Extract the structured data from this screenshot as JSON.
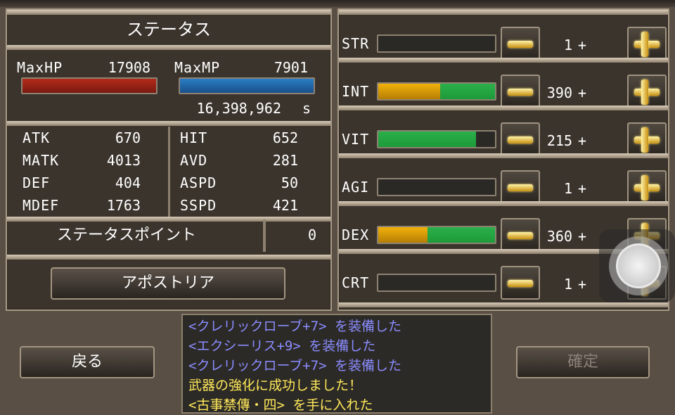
{
  "status_panel": {
    "title": "ステータス",
    "maxhp_label": "MaxHP",
    "maxhp_value": "17908",
    "maxmp_label": "MaxMP",
    "maxmp_value": "7901",
    "hp_fill": 1.0,
    "mp_fill": 1.0,
    "hp_color": "#b32a1a",
    "mp_color": "#2a7ec4",
    "time_value": "16,398,962",
    "time_unit": "s",
    "stats": [
      {
        "label": "ATK",
        "value": "670"
      },
      {
        "label": "MATK",
        "value": "4013"
      },
      {
        "label": "DEF",
        "value": "404"
      },
      {
        "label": "MDEF",
        "value": "1763"
      }
    ],
    "stats_right": [
      {
        "label": "HIT",
        "value": "652"
      },
      {
        "label": "AVD",
        "value": "281"
      },
      {
        "label": "ASPD",
        "value": "50"
      },
      {
        "label": "SSPD",
        "value": "421"
      }
    ],
    "points_label": "ステータスポイント",
    "points_value": "0",
    "class_button": "アポストリア"
  },
  "attributes": [
    {
      "label": "STR",
      "value": "1",
      "yellow": 0,
      "green": 0
    },
    {
      "label": "INT",
      "value": "390",
      "yellow": 0.53,
      "green": 0.47
    },
    {
      "label": "VIT",
      "value": "215",
      "yellow": 0,
      "green": 0.84
    },
    {
      "label": "AGI",
      "value": "1",
      "yellow": 0,
      "green": 0
    },
    {
      "label": "DEX",
      "value": "360",
      "yellow": 0.42,
      "green": 0.58
    },
    {
      "label": "CRT",
      "value": "1",
      "yellow": 0,
      "green": 0
    }
  ],
  "plus_suffix": "+",
  "colors": {
    "yellow": "#f2b20a",
    "green": "#1e9a3a",
    "log_blue": "#8a8cff",
    "log_yellow": "#ffe85a"
  },
  "footer": {
    "back_button": "戻る",
    "confirm_button": "確定"
  },
  "log": [
    {
      "text": "<クレリックローブ+7> を装備した",
      "color": "blue"
    },
    {
      "text": "<エクシーリス+9> を装備した",
      "color": "blue"
    },
    {
      "text": "<クレリックローブ+7> を装備した",
      "color": "blue"
    },
    {
      "text": "武器の強化に成功しました！",
      "color": "yellow"
    },
    {
      "text": "<古事禁傳・四> を手に入れた",
      "color": "yellow"
    }
  ]
}
